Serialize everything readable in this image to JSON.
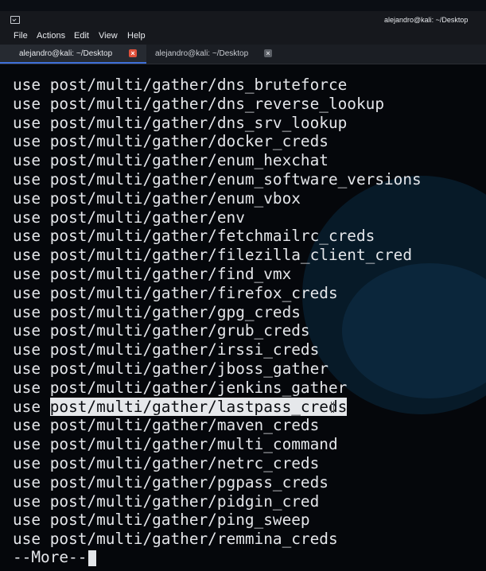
{
  "window": {
    "title": "alejandro@kali: ~/Desktop"
  },
  "menu": [
    "File",
    "Actions",
    "Edit",
    "View",
    "Help"
  ],
  "tabs": [
    {
      "label": "alejandro@kali: ~/Desktop",
      "active": true
    },
    {
      "label": "alejandro@kali: ~/Desktop",
      "active": false
    }
  ],
  "terminal": {
    "lines": [
      {
        "cmd": "use",
        "arg": "post/multi/gather/dns_bruteforce"
      },
      {
        "cmd": "use",
        "arg": "post/multi/gather/dns_reverse_lookup"
      },
      {
        "cmd": "use",
        "arg": "post/multi/gather/dns_srv_lookup"
      },
      {
        "cmd": "use",
        "arg": "post/multi/gather/docker_creds"
      },
      {
        "cmd": "use",
        "arg": "post/multi/gather/enum_hexchat"
      },
      {
        "cmd": "use",
        "arg": "post/multi/gather/enum_software_versions"
      },
      {
        "cmd": "use",
        "arg": "post/multi/gather/enum_vbox"
      },
      {
        "cmd": "use",
        "arg": "post/multi/gather/env"
      },
      {
        "cmd": "use",
        "arg": "post/multi/gather/fetchmailrc_creds"
      },
      {
        "cmd": "use",
        "arg": "post/multi/gather/filezilla_client_cred"
      },
      {
        "cmd": "use",
        "arg": "post/multi/gather/find_vmx"
      },
      {
        "cmd": "use",
        "arg": "post/multi/gather/firefox_creds"
      },
      {
        "cmd": "use",
        "arg": "post/multi/gather/gpg_creds"
      },
      {
        "cmd": "use",
        "arg": "post/multi/gather/grub_creds"
      },
      {
        "cmd": "use",
        "arg": "post/multi/gather/irssi_creds"
      },
      {
        "cmd": "use",
        "arg": "post/multi/gather/jboss_gather"
      },
      {
        "cmd": "use",
        "arg": "post/multi/gather/jenkins_gather"
      },
      {
        "cmd": "use",
        "arg": "post/multi/gather/lastpass_creds",
        "selected": true
      },
      {
        "cmd": "use",
        "arg": "post/multi/gather/maven_creds"
      },
      {
        "cmd": "use",
        "arg": "post/multi/gather/multi_command"
      },
      {
        "cmd": "use",
        "arg": "post/multi/gather/netrc_creds"
      },
      {
        "cmd": "use",
        "arg": "post/multi/gather/pgpass_creds"
      },
      {
        "cmd": "use",
        "arg": "post/multi/gather/pidgin_cred"
      },
      {
        "cmd": "use",
        "arg": "post/multi/gather/ping_sweep"
      },
      {
        "cmd": "use",
        "arg": "post/multi/gather/remmina_creds"
      }
    ],
    "pager_prompt": "--More--"
  },
  "colors": {
    "background": "#05070b",
    "text": "#e4e6ea",
    "active_tab_close": "#e0503a",
    "tab_indicator": "#3e6fd8"
  }
}
